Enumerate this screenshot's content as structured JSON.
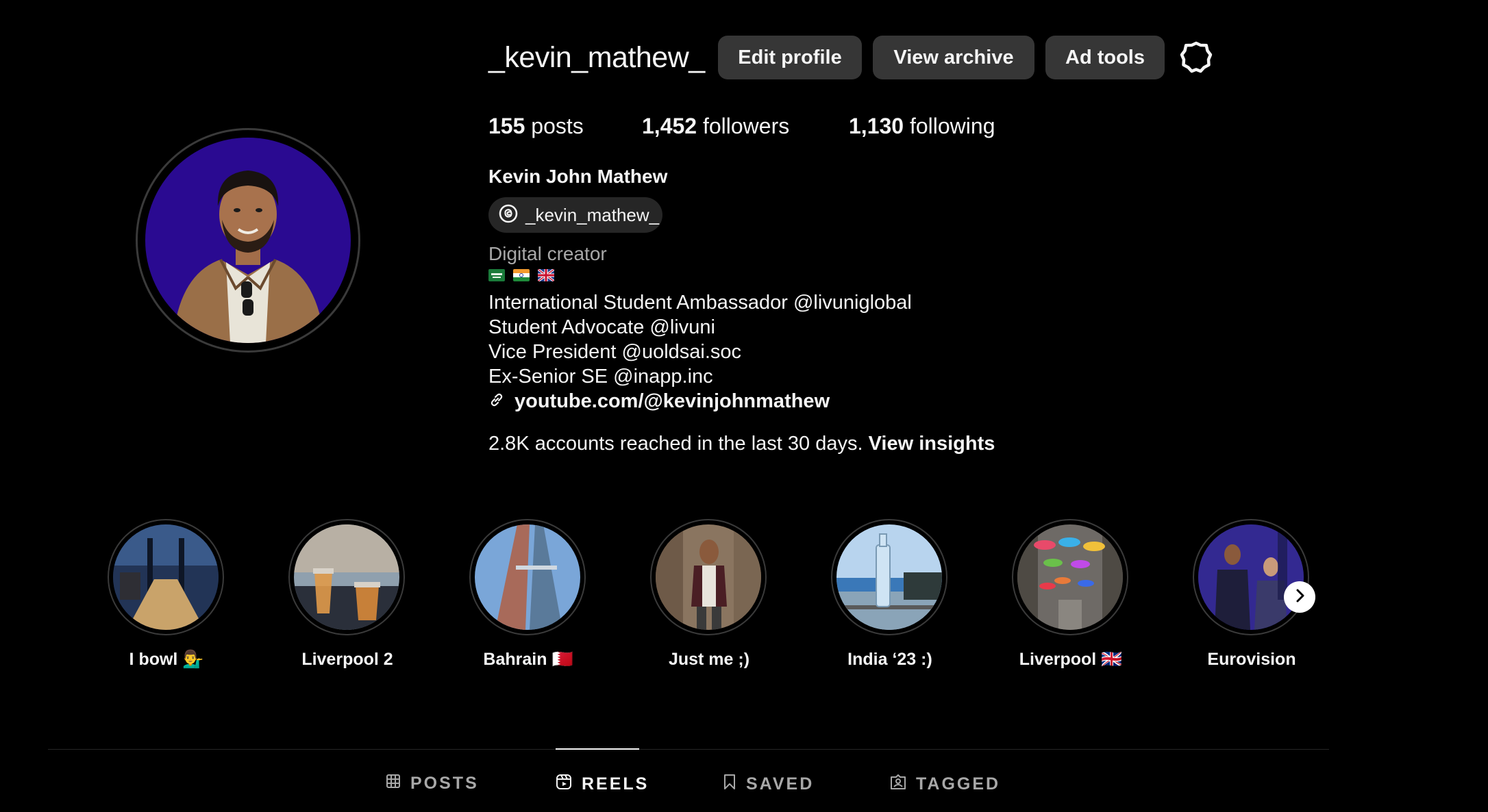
{
  "profile": {
    "username": "_kevin_mathew_",
    "full_name": "Kevin John Mathew",
    "threads_handle": "_kevin_mathew_",
    "category": "Digital creator",
    "flags": [
      "saudi-arabia-flag",
      "india-flag",
      "uk-flag"
    ],
    "bio_lines": [
      "International Student Ambassador @livuniglobal",
      "Student Advocate @livuni",
      "Vice President @uoldsai.soc",
      "Ex-Senior SE @inapp.inc"
    ],
    "link": "youtube.com/@kevinjohnmathew"
  },
  "actions": {
    "edit_profile": "Edit profile",
    "view_archive": "View archive",
    "ad_tools": "Ad tools",
    "settings_icon": "gear-icon"
  },
  "stats": {
    "posts_count": "155",
    "posts_label": "posts",
    "followers_count": "1,452",
    "followers_label": "followers",
    "following_count": "1,130",
    "following_label": "following"
  },
  "insights": {
    "text": "2.8K accounts reached in the last 30 days.",
    "link": "View insights"
  },
  "highlights": [
    {
      "label": "I bowl 💁‍♂️"
    },
    {
      "label": "Liverpool 2"
    },
    {
      "label": "Bahrain 🇧🇭"
    },
    {
      "label": "Just me ;)"
    },
    {
      "label": "India ‘23 :)"
    },
    {
      "label": "Liverpool 🇬🇧"
    },
    {
      "label": "Eurovision"
    }
  ],
  "tabs": [
    {
      "label": "POSTS",
      "icon": "grid-icon",
      "active": false
    },
    {
      "label": "REELS",
      "icon": "reels-icon",
      "active": true
    },
    {
      "label": "SAVED",
      "icon": "bookmark-icon",
      "active": false
    },
    {
      "label": "TAGGED",
      "icon": "tag-icon",
      "active": false
    }
  ]
}
